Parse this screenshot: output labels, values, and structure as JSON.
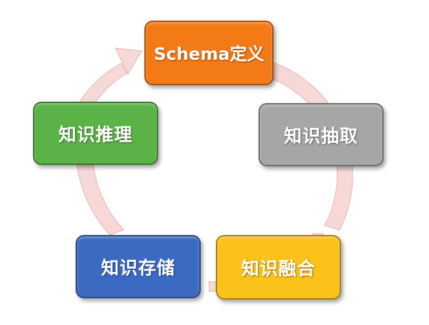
{
  "nodes": [
    {
      "id": "schema",
      "label": "Schema定义",
      "color": "#F47A16"
    },
    {
      "id": "extract",
      "label": "知识抽取",
      "color": "#A6A6A6"
    },
    {
      "id": "fusion",
      "label": "知识融合",
      "color": "#FBC21A"
    },
    {
      "id": "storage",
      "label": "知识存储",
      "color": "#3C6AC2"
    },
    {
      "id": "reason",
      "label": "知识推理",
      "color": "#5BB246"
    }
  ],
  "cycle_arrow": {
    "fill": "#F6D9D6",
    "stroke": "#E0B4B0"
  }
}
